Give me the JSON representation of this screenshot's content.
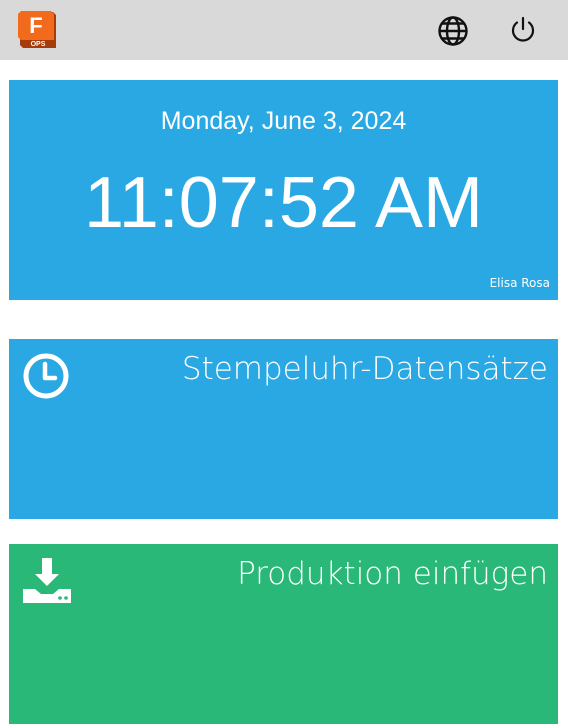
{
  "header": {
    "logo": {
      "letter": "F",
      "sub": "OPS",
      "colors": {
        "primary": "#f26b1d",
        "dark": "#a63c0c"
      }
    },
    "icons": {
      "language": "globe-icon",
      "power": "power-icon"
    }
  },
  "clock": {
    "date": "Monday, June 3, 2024",
    "time": "11:07:52 AM",
    "user": "Elisa Rosa",
    "color": "#29a8e3"
  },
  "tiles": [
    {
      "label": "Stempeluhr-Datensätze",
      "icon": "clock-icon",
      "color": "#29a8e3"
    },
    {
      "label": "Produktion einfügen",
      "icon": "download-icon",
      "color": "#29b877"
    }
  ]
}
